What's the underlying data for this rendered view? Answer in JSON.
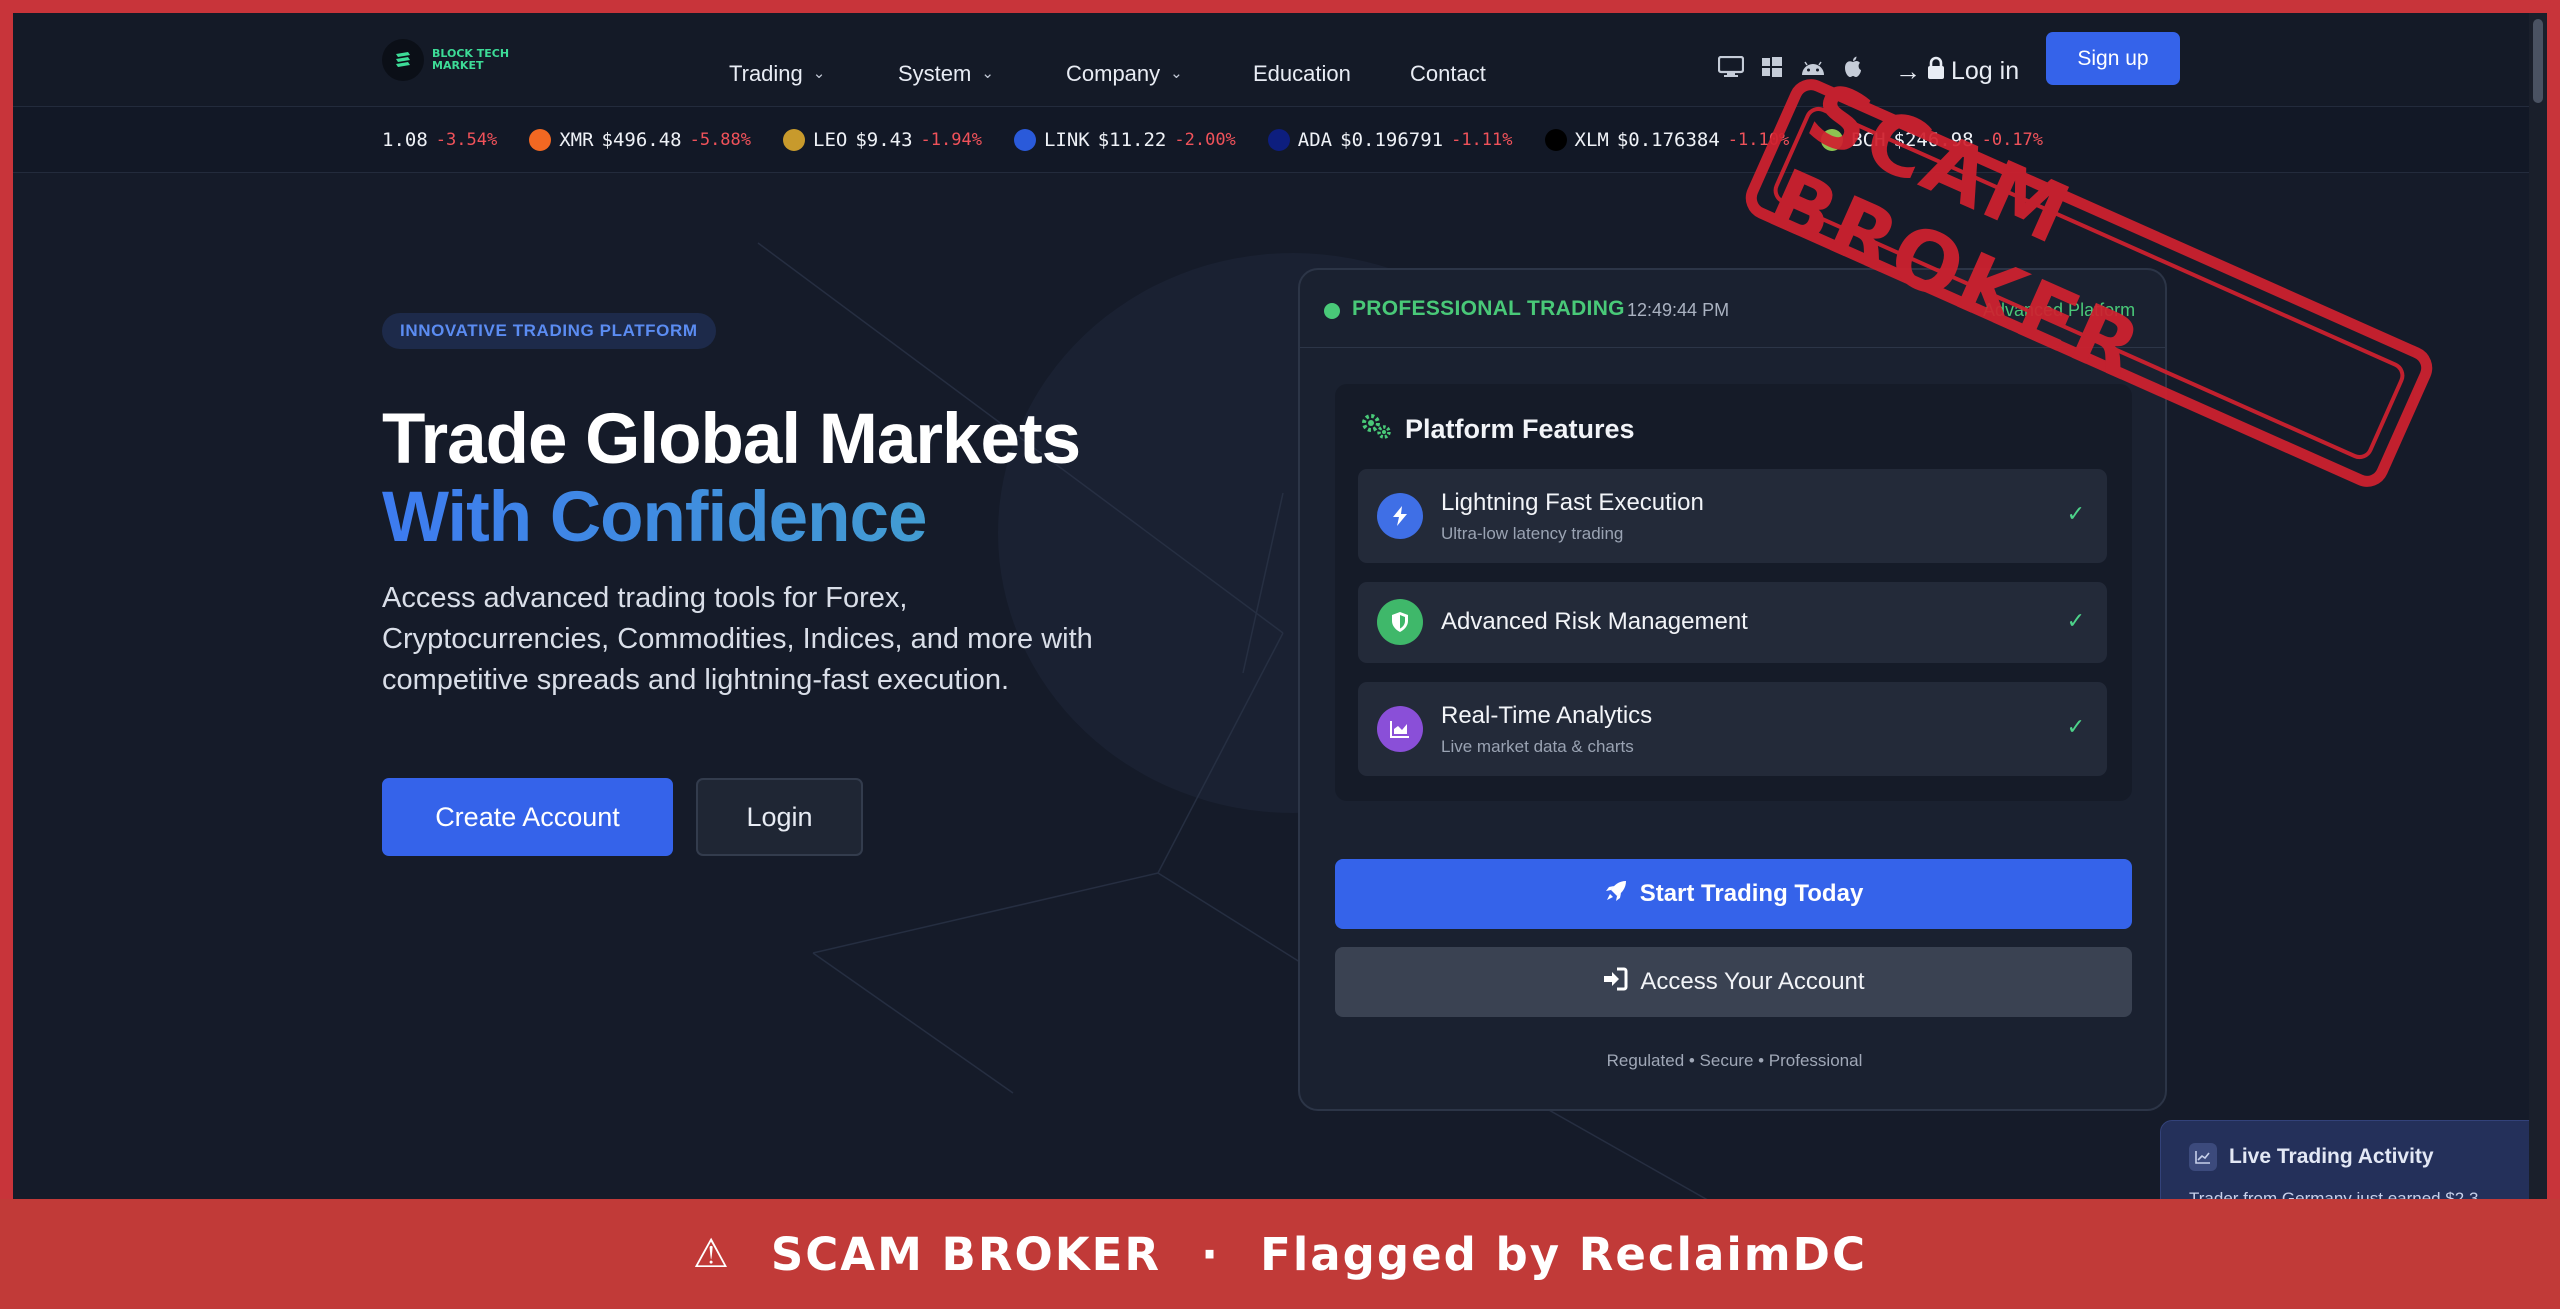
{
  "logo": {
    "line1": "BLOCK TECH",
    "line2": "MARKET"
  },
  "nav": {
    "items": [
      {
        "label": "Trading",
        "dropdown": true
      },
      {
        "label": "System",
        "dropdown": true
      },
      {
        "label": "Company",
        "dropdown": true
      },
      {
        "label": "Education",
        "dropdown": false
      },
      {
        "label": "Contact",
        "dropdown": false
      }
    ],
    "login_label": "Log in",
    "signup_label": "Sign up",
    "platform_icons": [
      "desktop-icon",
      "windows-icon",
      "android-icon",
      "apple-icon"
    ]
  },
  "ticker": [
    {
      "symbol": "",
      "price": "1.08",
      "change": "-3.54%",
      "color": ""
    },
    {
      "symbol": "XMR",
      "price": "$496.48",
      "change": "-5.88%",
      "color": "#f26822"
    },
    {
      "symbol": "LEO",
      "price": "$9.43",
      "change": "-1.94%",
      "color": "#c89a2c"
    },
    {
      "symbol": "LINK",
      "price": "$11.22",
      "change": "-2.00%",
      "color": "#2a5ada"
    },
    {
      "symbol": "ADA",
      "price": "$0.196791",
      "change": "-1.11%",
      "color": "#0d1e7e"
    },
    {
      "symbol": "XLM",
      "price": "$0.176384",
      "change": "-1.10%",
      "color": "#000000"
    },
    {
      "symbol": "BCH",
      "price": "$246.98",
      "change": "-0.17%",
      "color": "#8dc351"
    }
  ],
  "hero": {
    "badge": "INNOVATIVE TRADING PLATFORM",
    "title_line1": "Trade Global Markets",
    "title_line2": "With Confidence",
    "description": "Access advanced trading tools for Forex, Cryptocurrencies, Commodities, Indices, and more with competitive spreads and lightning-fast execution.",
    "create_account": "Create Account",
    "login": "Login"
  },
  "card": {
    "status_label": "PROFESSIONAL TRADING",
    "time": "12:49:44 PM",
    "right_label": "Advanced Platform",
    "features_title": "Platform Features",
    "features": [
      {
        "name": "Lightning Fast Execution",
        "sub": "Ultra-low latency trading",
        "icon": "lightning-icon",
        "color": "#3f6fe6"
      },
      {
        "name": "Advanced Risk Management",
        "sub": "",
        "icon": "shield-icon",
        "color": "#3fb86a"
      },
      {
        "name": "Real-Time Analytics",
        "sub": "Live market data & charts",
        "icon": "chart-icon",
        "color": "#8a4fd8"
      }
    ],
    "start_button": "Start Trading Today",
    "access_button": "Access Your Account",
    "footer": "Regulated • Secure • Professional"
  },
  "live_activity": {
    "title": "Live Trading Activity",
    "text": "Trader from Germany just earned $2,3"
  },
  "stamp": {
    "text": "SCAM BROKER"
  },
  "banner": {
    "icon": "⚠",
    "text1": "SCAM BROKER",
    "separator": "·",
    "text2": "Flagged by ReclaimDC"
  }
}
